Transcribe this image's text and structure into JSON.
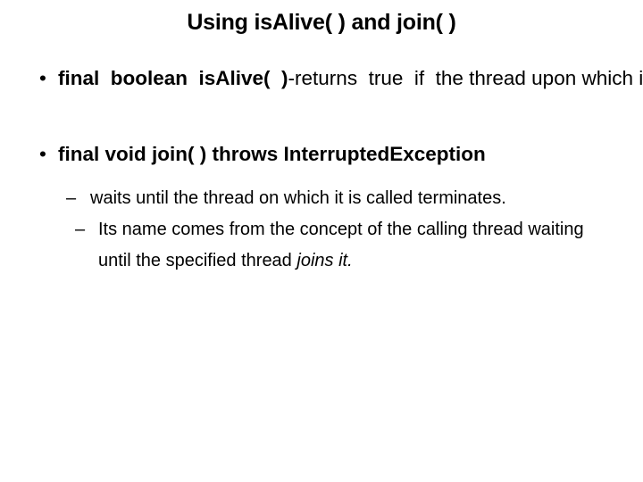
{
  "slide": {
    "title": "Using isAlive( ) and join( )",
    "background_color": "#ffffff",
    "text_color": "#000000",
    "bullets": [
      {
        "level": 1,
        "marker": "•",
        "bold_prefix": "final  boolean  isAlive(  )",
        "rest": "-returns  true  if  the thread upon which it is called is still running. It returns false otherwise."
      },
      {
        "level": 1,
        "marker": "•",
        "bold_prefix": "final void join( ) throws InterruptedException",
        "rest": ""
      },
      {
        "level": 2,
        "marker": "–",
        "text": " waits until the thread on which it is called terminates."
      },
      {
        "level": 2,
        "marker": "–",
        "text_plain": "Its name comes from the concept of the calling thread waiting until the specified thread ",
        "text_italic": "joins it."
      }
    ]
  }
}
